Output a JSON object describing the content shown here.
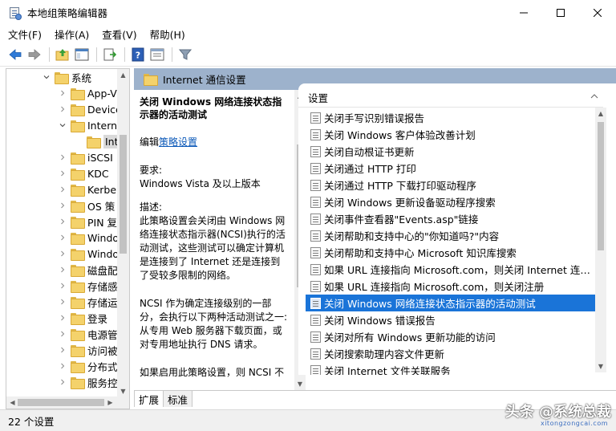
{
  "window": {
    "title": "本地组策略编辑器"
  },
  "menu": [
    "文件(F)",
    "操作(A)",
    "查看(V)",
    "帮助(H)"
  ],
  "toolbar": {
    "buttons": [
      "back-arrow-icon",
      "forward-arrow-icon",
      "up-folder-icon",
      "show-hide-tree-icon",
      "export-list-icon",
      "help-icon",
      "properties-icon",
      "filter-icon"
    ]
  },
  "tree": {
    "items": [
      {
        "label": "系统",
        "arrow": "expanded"
      },
      {
        "label": "App-V",
        "arrow": "collapsed"
      },
      {
        "label": "Device",
        "arrow": "collapsed"
      },
      {
        "label": "Intern",
        "arrow": "expanded"
      },
      {
        "label": "Int",
        "arrow": "none"
      },
      {
        "label": "iSCSI",
        "arrow": "collapsed"
      },
      {
        "label": "KDC",
        "arrow": "collapsed"
      },
      {
        "label": "Kerbe",
        "arrow": "collapsed"
      },
      {
        "label": "OS 策",
        "arrow": "collapsed"
      },
      {
        "label": "PIN 复",
        "arrow": "collapsed"
      },
      {
        "label": "Windo",
        "arrow": "collapsed"
      },
      {
        "label": "Windo",
        "arrow": "collapsed"
      },
      {
        "label": "磁盘配",
        "arrow": "collapsed"
      },
      {
        "label": "存储感",
        "arrow": "collapsed"
      },
      {
        "label": "存储运",
        "arrow": "collapsed"
      },
      {
        "label": "登录",
        "arrow": "collapsed"
      },
      {
        "label": "电源管",
        "arrow": "collapsed"
      },
      {
        "label": "访问被",
        "arrow": "collapsed"
      },
      {
        "label": "分布式",
        "arrow": "collapsed"
      },
      {
        "label": "服务控",
        "arrow": "collapsed"
      }
    ]
  },
  "pane": {
    "header": "Internet 通信设置"
  },
  "description": {
    "title": "关闭 Windows 网络连接状态指示器的活动测试",
    "edit_prefix": "编辑",
    "edit_link": "策略设置",
    "requirements_label": "要求:",
    "requirements_value": "Windows Vista 及以上版本",
    "desc_label": "描述:",
    "desc_text": "此策略设置会关闭由 Windows 网络连接状态指示器(NCSI)执行的活动测试，这些测试可以确定计算机是连接到了 Internet 还是连接到了受较多限制的网络。",
    "ncsi_text": "NCSI 作为确定连接级别的一部分，会执行以下两种活动测试之一: 从专用 Web 服务器下载页面，或对专用地址执行 DNS 请求。",
    "cut_text": "如果启用此策略设置，则 NCSI 不"
  },
  "settings": {
    "column_header": "设置",
    "rows": [
      "关闭手写识别错误报告",
      "关闭 Windows 客户体验改善计划",
      "关闭自动根证书更新",
      "关闭通过 HTTP 打印",
      "关闭通过 HTTP 下载打印驱动程序",
      "关闭 Windows 更新设备驱动程序搜索",
      "关闭事件查看器\"Events.asp\"链接",
      "关闭帮助和支持中心的\"你知道吗?\"内容",
      "关闭帮助和支持中心 Microsoft 知识库搜索",
      "如果 URL 连接指向 Microsoft.com，则关闭 Internet 连接...",
      "如果 URL 连接指向 Microsoft.com，则关闭注册",
      "关闭 Windows 网络连接状态指示器的活动测试",
      "关闭 Windows 错误报告",
      "关闭对所有 Windows 更新功能的访问",
      "关闭搜索助理内容文件更新",
      "关闭 Internet 文件关联服务"
    ],
    "selected_index": 11
  },
  "tabs": [
    "扩展",
    "标准"
  ],
  "status": {
    "text": "22 个设置"
  },
  "watermark": {
    "main": "头条 @系统总裁",
    "sub": "xitongzongcai.com"
  }
}
